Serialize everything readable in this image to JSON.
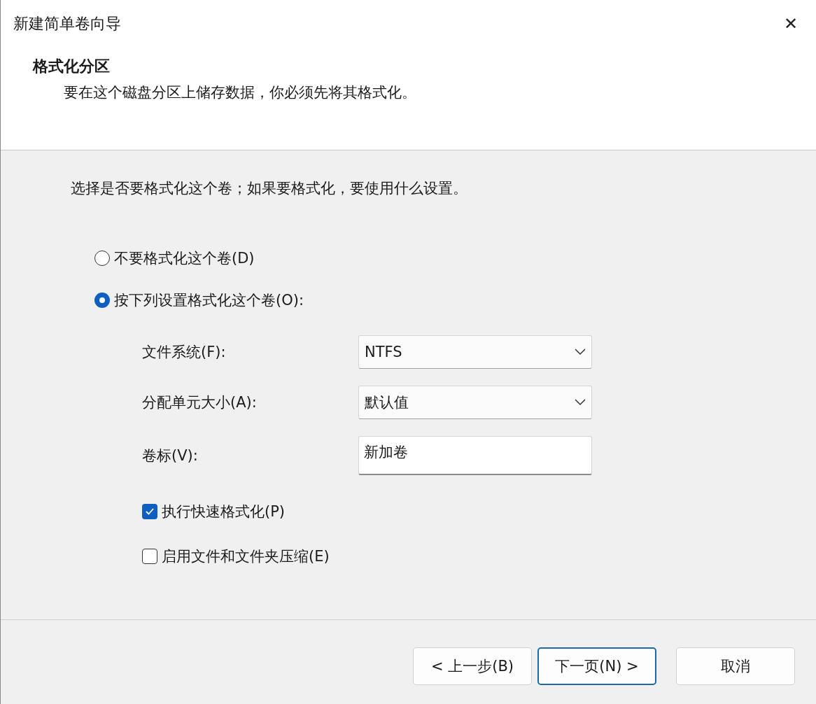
{
  "window": {
    "title": "新建简单卷向导",
    "close": "✕"
  },
  "header": {
    "title": "格式化分区",
    "description": "要在这个磁盘分区上储存数据，你必须先将其格式化。"
  },
  "instruction": "选择是否要格式化这个卷；如果要格式化，要使用什么设置。",
  "options": [
    {
      "label": "不要格式化这个卷(D)",
      "selected": false
    },
    {
      "label": "按下列设置格式化这个卷(O):",
      "selected": true
    }
  ],
  "fields": [
    {
      "kind": "select",
      "label": "文件系统(F):",
      "value": "NTFS"
    },
    {
      "kind": "select",
      "label": "分配单元大小(A):",
      "value": "默认值"
    },
    {
      "kind": "text",
      "label": "卷标(V):",
      "value": "新加卷"
    }
  ],
  "checkboxes": [
    {
      "label": "执行快速格式化(P)",
      "checked": true
    },
    {
      "label": "启用文件和文件夹压缩(E)",
      "checked": false
    }
  ],
  "buttons": [
    {
      "label": "< 上一步(B)",
      "default": false
    },
    {
      "label": "下一页(N) >",
      "default": true
    },
    {
      "label": "取消",
      "default": false
    }
  ]
}
